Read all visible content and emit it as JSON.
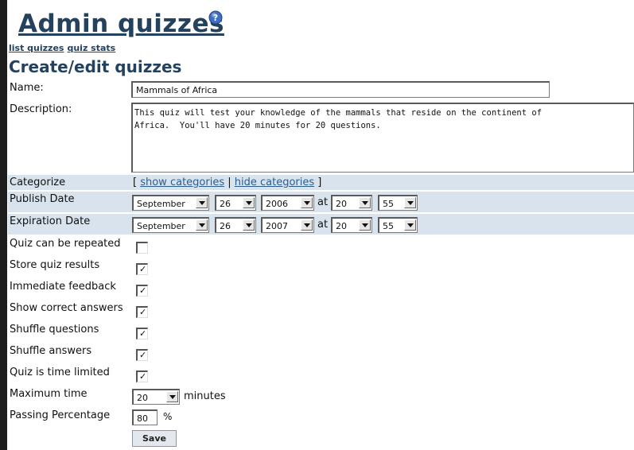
{
  "header": {
    "title": "Admin quizzes",
    "help_icon": "help-question-icon",
    "links": [
      "list quizzes",
      "quiz stats"
    ],
    "section_title": "Create/edit quizzes"
  },
  "form": {
    "name_label": "Name:",
    "name_value": "Mammals of Africa",
    "description_label": "Description:",
    "description_value": "This quiz will test your knowledge of the mammals that reside on the continent of\nAfrica.  You'll have 20 minutes for 20 questions.",
    "categorize_label": "Categorize",
    "categorize_open": "[ ",
    "show_categories": "show categories",
    "categorize_sep": " | ",
    "hide_categories": "hide categories",
    "categorize_close": " ]",
    "publish_label": "Publish Date",
    "publish": {
      "month": "September",
      "day": "26",
      "year": "2006",
      "at": "at",
      "hour": "20",
      "minute": "55"
    },
    "expiration_label": "Expiration Date",
    "expiration": {
      "month": "September",
      "day": "26",
      "year": "2007",
      "at": "at",
      "hour": "20",
      "minute": "55"
    },
    "checkboxes": [
      {
        "label": "Quiz can be repeated",
        "checked": false
      },
      {
        "label": "Store quiz results",
        "checked": true
      },
      {
        "label": "Immediate feedback",
        "checked": true
      },
      {
        "label": "Show correct answers",
        "checked": true
      },
      {
        "label": "Shuffle questions",
        "checked": true
      },
      {
        "label": "Shuffle answers",
        "checked": true
      },
      {
        "label": "Quiz is time limited",
        "checked": true
      }
    ],
    "max_time_label": "Maximum time",
    "max_time_value": "20",
    "max_time_unit": "minutes",
    "passing_label": "Passing Percentage",
    "passing_value": "80",
    "passing_unit": "%",
    "save_label": "Save"
  },
  "colors": {
    "title": "#24415e",
    "shaded_row": "#d8e3ed",
    "link": "#2b5e8e"
  }
}
